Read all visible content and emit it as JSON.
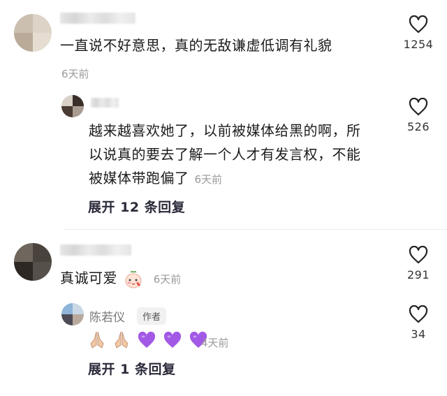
{
  "comments": [
    {
      "text": "一直说不好意思，真的无敌谦虚低调有礼貌",
      "time": "6天前",
      "likes": "1254",
      "avatar_icon": "blurred-avatar",
      "replies": [
        {
          "text_lines": [
            "越来越喜欢她了，以前被媒体给黑的啊，所",
            "以说真的要去了解一个人才有发言权，不能",
            "被媒体带跑偏了"
          ],
          "time": "6天前",
          "likes": "526",
          "avatar_icon": "blurred-avatar"
        }
      ],
      "expand_label": "展开 12 条回复"
    },
    {
      "text": "真诚可爱",
      "emoji": "shy-face-emoji",
      "time": "6天前",
      "likes": "291",
      "avatar_icon": "blurred-avatar",
      "replies": [
        {
          "author": "陈若仪",
          "author_badge": "作者",
          "emojis": [
            "folded-hands-emoji",
            "folded-hands-emoji",
            "purple-heart-emoji",
            "purple-heart-emoji",
            "purple-heart-emoji"
          ],
          "time": "4天前",
          "likes": "34",
          "avatar_icon": "author-avatar"
        }
      ],
      "expand_label": "展开 1 条回复"
    }
  ],
  "colors": {
    "text": "#1b1b1b",
    "muted": "#9a9a9a",
    "heart_outline": "#222222",
    "purple_heart": "#a259e6",
    "divider": "#ececec"
  }
}
